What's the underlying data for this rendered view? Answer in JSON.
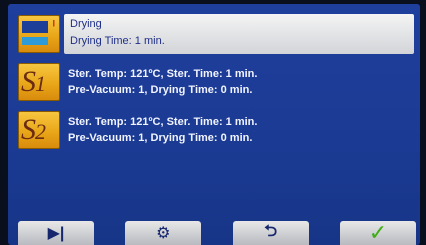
{
  "programs": [
    {
      "id": "drying",
      "line1": "Drying",
      "line2": "Drying Time: 1 min.",
      "selected": true,
      "icon": "drying-program-icon"
    },
    {
      "id": "s1",
      "glyph": "S",
      "glyph_sub": "1",
      "line1": "Ster. Temp: 121ºC, Ster. Time: 1 min.",
      "line2": "Pre-Vacuum: 1, Drying Time: 0 min.",
      "icon": "program-s1-icon"
    },
    {
      "id": "s2",
      "glyph": "S",
      "glyph_sub": "2",
      "line1": "Ster. Temp: 121ºC, Ster. Time: 1 min.",
      "line2": "Pre-Vacuum: 1, Drying Time: 0 min.",
      "icon": "program-s2-icon"
    }
  ],
  "toolbar": {
    "play_icon": "▶|",
    "settings_icon": "⚙",
    "back_icon": "⮌",
    "confirm_icon": "✓"
  },
  "colors": {
    "accent": "#e9a719",
    "background": "#1f3f9c",
    "confirm": "#3fae16"
  }
}
